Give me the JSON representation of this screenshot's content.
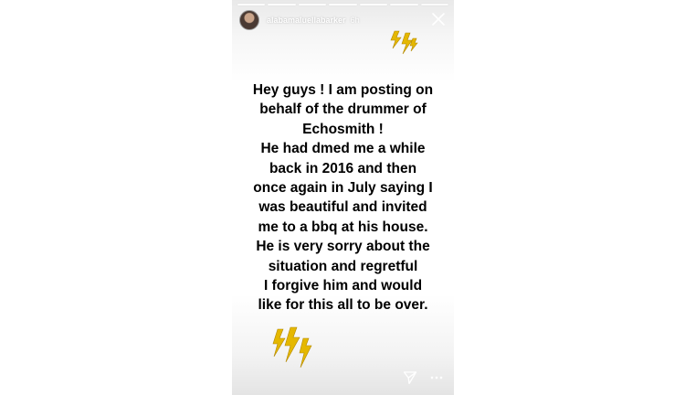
{
  "story": {
    "username": "alabamaluellabarker",
    "time": "6h",
    "text": "Hey guys ! I am posting on\nbehalf of the drummer of\nEchosmith !\nHe had dmed me a while\nback in 2016  and then\nonce again in July saying I\nwas beautiful and invited\nme to a bbq at his house.\nHe is very sorry about the\nsituation and regretful\nI forgive him and would\nlike for this all to be over.",
    "segments": 7,
    "icons": {
      "close": "close-icon",
      "send": "send-icon",
      "more": "more-icon",
      "sticker": "lightning-bolt-icon"
    },
    "colors": {
      "bolt": "#e5b800",
      "bolt_stroke": "#b38800",
      "text": "#000000"
    }
  }
}
